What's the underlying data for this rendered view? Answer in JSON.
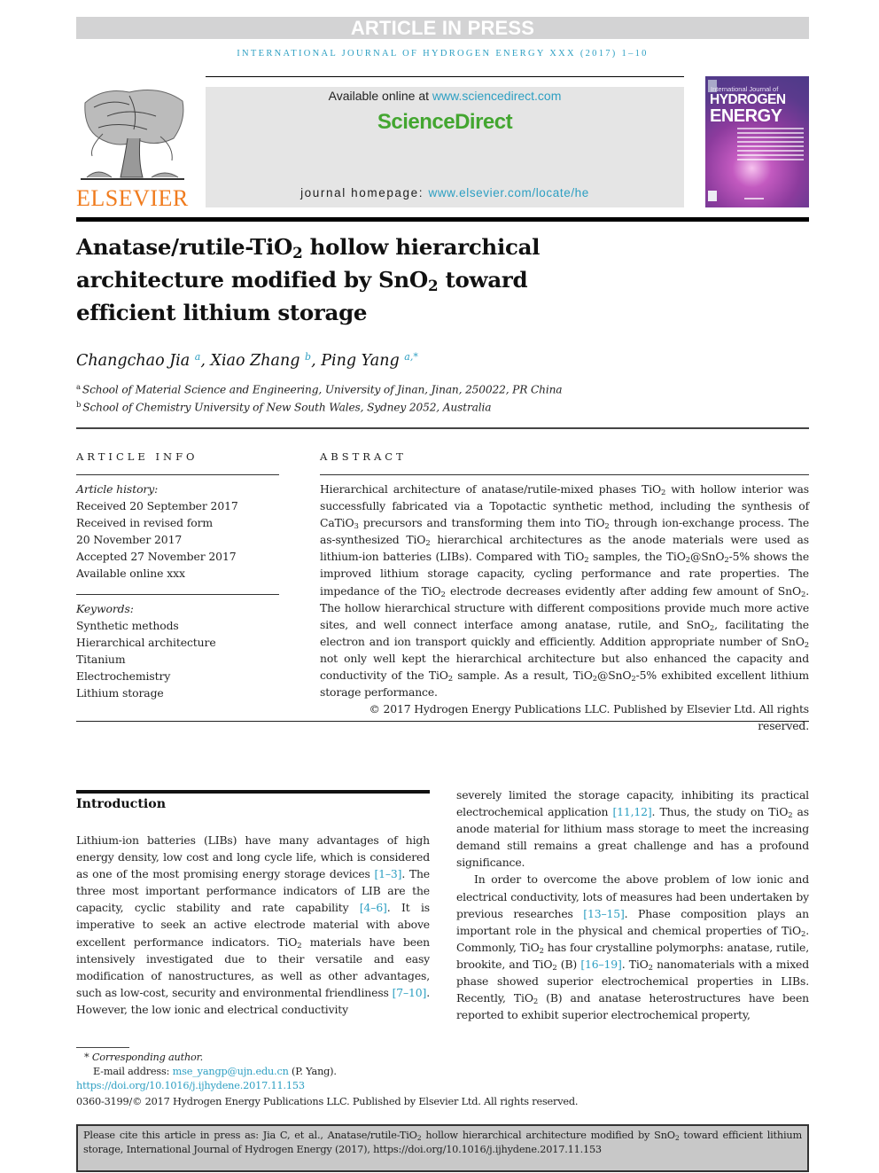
{
  "banner": {
    "text": "ARTICLE IN PRESS"
  },
  "journal_line": "INTERNATIONAL JOURNAL OF HYDROGEN ENERGY XXX (2017) 1–10",
  "publisher": {
    "name": "ELSEVIER",
    "logo_icon": "elsevier-tree-icon"
  },
  "sciencedirect": {
    "available_prefix": "Available online at ",
    "available_link": "www.sciencedirect.com",
    "logo_text": "ScienceDirect",
    "homepage_label": "journal homepage: ",
    "homepage_link": "www.elsevier.com/locate/he"
  },
  "cover": {
    "line1": "International Journal of",
    "line2": "HYDROGEN",
    "line3": "ENERGY"
  },
  "article": {
    "title_parts": [
      "Anatase/rutile-TiO",
      "2",
      " hollow hierarchical architecture modified by SnO",
      "2",
      " toward efficient lithium storage"
    ],
    "authors": [
      {
        "name": "Changchao Jia",
        "sup": "a"
      },
      {
        "name": "Xiao Zhang",
        "sup": "b"
      },
      {
        "name": "Ping Yang",
        "sup": "a,*"
      }
    ],
    "affiliations": [
      {
        "mark": "a",
        "text": "School of Material Science and Engineering, University of Jinan, Jinan, 250022, PR China"
      },
      {
        "mark": "b",
        "text": "School of Chemistry University of New South Wales, Sydney 2052, Australia"
      }
    ]
  },
  "article_info": {
    "heading": "ARTICLE INFO",
    "history_label": "Article history:",
    "history": [
      "Received 20 September 2017",
      "Received in revised form",
      "20 November 2017",
      "Accepted 27 November 2017",
      "Available online xxx"
    ],
    "keywords_label": "Keywords:",
    "keywords": [
      "Synthetic methods",
      "Hierarchical architecture",
      "Titanium",
      "Electrochemistry",
      "Lithium storage"
    ]
  },
  "abstract": {
    "heading": "ABSTRACT",
    "copyright": "© 2017 Hydrogen Energy Publications LLC. Published by Elsevier Ltd. All rights reserved."
  },
  "introduction": {
    "heading": "Introduction",
    "refs": [
      "[1–3]",
      "[4–6]",
      "[7–10]",
      "[11,12]",
      "[13–15]",
      "[16–19]"
    ]
  },
  "footnotes": {
    "corresponding": "* Corresponding author.",
    "email_label": "E-mail address: ",
    "email": "mse_yangp@ujn.edu.cn",
    "email_suffix": " (P. Yang).",
    "doi": "https://doi.org/10.1016/j.ijhydene.2017.11.153",
    "issn_line": "0360-3199/© 2017 Hydrogen Energy Publications LLC. Published by Elsevier Ltd. All rights reserved."
  },
  "citation": {
    "prefix": "Please cite this article in press as: Jia C, et al., Anatase/rutile-TiO",
    "mid1": " hollow hierarchical architecture modified by SnO",
    "suffix": " toward efficient lithium storage, International Journal of Hydrogen Energy (2017), https://doi.org/10.1016/j.ijhydene.2017.11.153",
    "sub": "2"
  }
}
